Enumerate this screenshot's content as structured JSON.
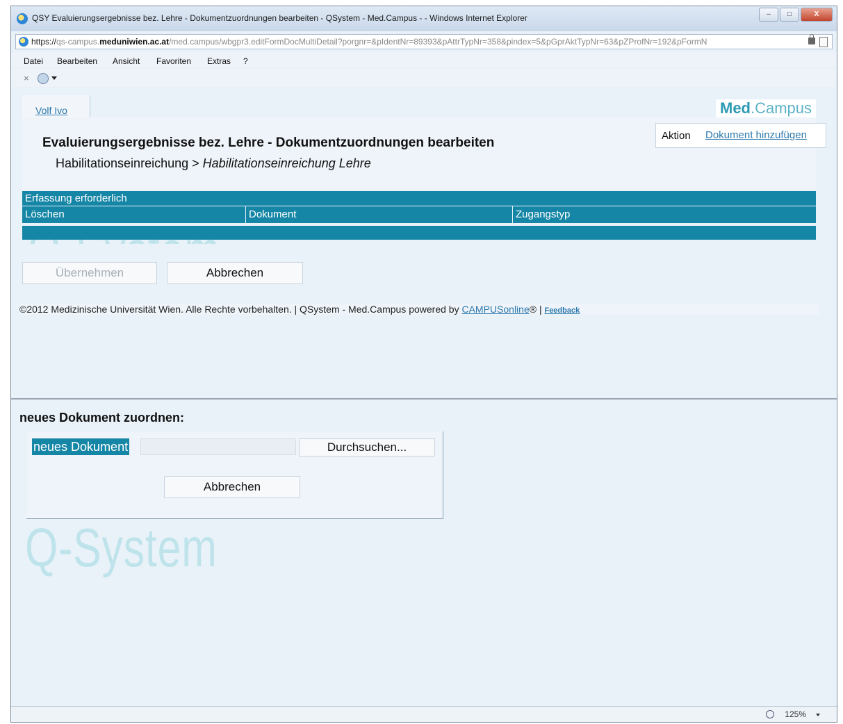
{
  "window": {
    "title": "QSY Evaluierungsergebnisse bez. Lehre - Dokumentzuordnungen bearbeiten - QSystem - Med.Campus - - Windows Internet Explorer",
    "minimize": "–",
    "maximize": "□",
    "close": "X"
  },
  "address": {
    "protocol": "https://",
    "subdomain": "qs-campus.",
    "domain": "meduniwien.ac.at",
    "path": "/med.campus/wbgpr3.editFormDocMultiDetail?porgnr=&pIdentNr=89393&pAttrTypNr=358&pindex=5&pGprAktTypNr=63&pZProfNr=192&pFormN"
  },
  "menu": {
    "items": [
      "Datei",
      "Bearbeiten",
      "Ansicht",
      "Favoriten",
      "Extras",
      "?"
    ]
  },
  "cmdbar": {
    "stop": "×"
  },
  "user_tab": {
    "name": "Volf Ivo"
  },
  "logo": {
    "part1": "Med",
    "part2": ".Campus"
  },
  "header": {
    "title": "Evaluierungsergebnisse bez. Lehre - Dokumentzuordnungen bearbeiten",
    "breadcrumb_parent": "Habilitationseinreichung",
    "breadcrumb_sep": " > ",
    "breadcrumb_current": "Habilitationseinreichung Lehre"
  },
  "action": {
    "label": "Aktion",
    "link": "Dokument hinzufügen"
  },
  "table": {
    "caption": "Erfassung erforderlich",
    "columns": [
      "Löschen",
      "Dokument",
      "Zugangstyp"
    ]
  },
  "watermark": "Q-System",
  "buttons": {
    "apply": "Übernehmen",
    "cancel": "Abbrechen"
  },
  "footer": {
    "copyright": "©2012 Medizinische Universität Wien. Alle Rechte vorbehalten. | QSystem - Med.Campus powered by ",
    "campusonline": "CAMPUSonline",
    "reg": "® | ",
    "feedback": "Feedback"
  },
  "upload": {
    "heading": "neues Dokument zuordnen:",
    "label": "neues Dokument",
    "browse": "Durchsuchen...",
    "cancel": "Abbrechen"
  },
  "status": {
    "zoom": "125%"
  }
}
